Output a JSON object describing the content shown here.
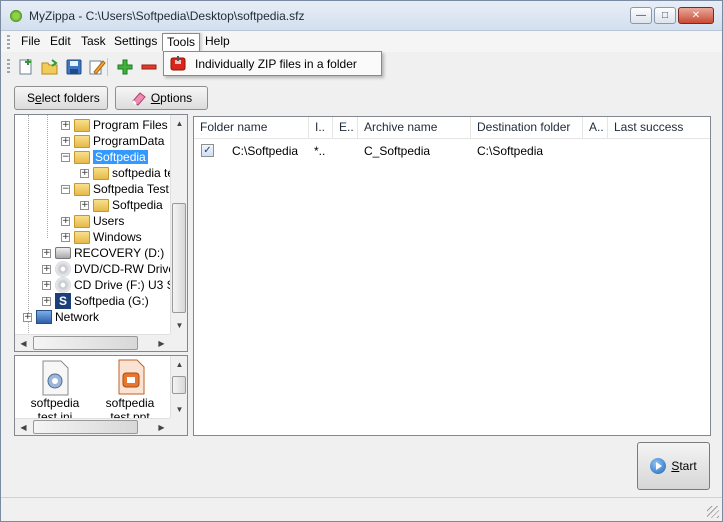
{
  "window": {
    "title": "MyZippa - C:\\Users\\Softpedia\\Desktop\\softpedia.sfz",
    "buttons": [
      "minimize",
      "maximize",
      "close"
    ]
  },
  "menu": {
    "items": [
      "File",
      "Edit",
      "Task",
      "Settings",
      "Tools",
      "Help"
    ],
    "active": "Tools"
  },
  "toolbar": {
    "icons": [
      "new-icon",
      "open-icon",
      "save-icon",
      "edit-icon",
      "add-icon",
      "remove-icon"
    ]
  },
  "tools_menu": {
    "items": [
      {
        "label": "Individually ZIP files in a folder",
        "icon": "zip-icon"
      }
    ]
  },
  "buttons": {
    "select_folders_prefix": "S",
    "select_folders_underline": "e",
    "select_folders_rest": "lect folders",
    "options_underline": "O",
    "options_rest": "ptions",
    "start_underline": "S",
    "start_rest": "tart"
  },
  "tree": {
    "items": [
      {
        "label": "Program Files",
        "type": "folder"
      },
      {
        "label": "ProgramData",
        "type": "folder"
      },
      {
        "label": "Softpedia",
        "type": "folder",
        "selected": true
      },
      {
        "label": "softpedia te",
        "type": "folder"
      },
      {
        "label": "Softpedia Test",
        "type": "folder"
      },
      {
        "label": "Softpedia",
        "type": "folder"
      },
      {
        "label": "Users",
        "type": "folder"
      },
      {
        "label": "Windows",
        "type": "folder"
      },
      {
        "label": "RECOVERY (D:)",
        "type": "drive"
      },
      {
        "label": "DVD/CD-RW Drive (",
        "type": "disc"
      },
      {
        "label": "CD Drive (F:) U3 Sy",
        "type": "disc"
      },
      {
        "label": "Softpedia (G:)",
        "type": "softpedia"
      },
      {
        "label": "Network",
        "type": "network"
      }
    ]
  },
  "files": [
    {
      "label_line1": "softpedia",
      "label_line2": "test.ini",
      "icon": "ini-file-icon"
    },
    {
      "label_line1": "softpedia",
      "label_line2": "test.ppt",
      "icon": "ppt-file-icon"
    }
  ],
  "list": {
    "columns": [
      "Folder name",
      "I..",
      "E..",
      "Archive name",
      "Destination folder",
      "A..",
      "Last success"
    ],
    "rows": [
      {
        "checked": true,
        "folder_name": "C:\\Softpedia",
        "include": "*..",
        "exclude": "",
        "archive_name": "C_Softpedia",
        "destination": "C:\\Softpedia",
        "a": "",
        "last_success": ""
      }
    ]
  },
  "colors": {
    "selection": "#3399ff",
    "titlebar": "#d3dfee",
    "close": "#c94a34"
  }
}
